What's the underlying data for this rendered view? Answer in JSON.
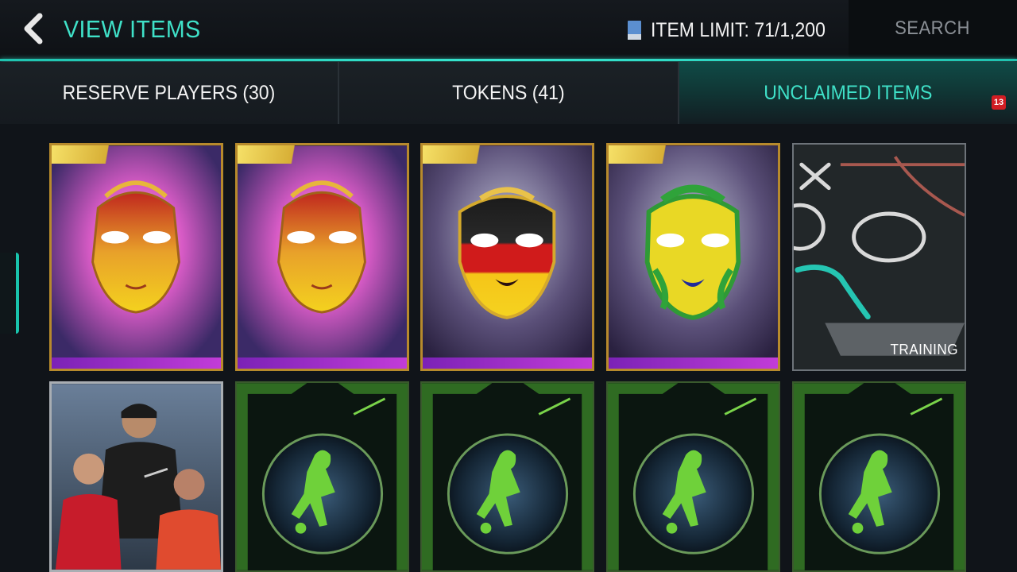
{
  "header": {
    "title": "VIEW ITEMS",
    "item_limit": "ITEM LIMIT: 71/1,200",
    "search_label": "SEARCH"
  },
  "tabs": [
    {
      "label": "RESERVE PLAYERS (30)",
      "active": false
    },
    {
      "label": "TOKENS (41)",
      "active": false
    },
    {
      "label": "UNCLAIMED ITEMS",
      "active": true,
      "badge": "13"
    }
  ],
  "cards": {
    "row1": [
      {
        "kind": "mask",
        "mask_color": "red-gold"
      },
      {
        "kind": "mask",
        "mask_color": "red-gold"
      },
      {
        "kind": "mask",
        "mask_color": "germany"
      },
      {
        "kind": "mask",
        "mask_color": "brazil"
      },
      {
        "kind": "training",
        "label": "TRAINING"
      }
    ],
    "row2": [
      {
        "kind": "players"
      },
      {
        "kind": "green-token"
      },
      {
        "kind": "green-token"
      },
      {
        "kind": "green-token"
      },
      {
        "kind": "green-token"
      }
    ]
  },
  "colors": {
    "accent": "#3fe1c8",
    "badge": "#d11d23",
    "background": "#101419"
  }
}
